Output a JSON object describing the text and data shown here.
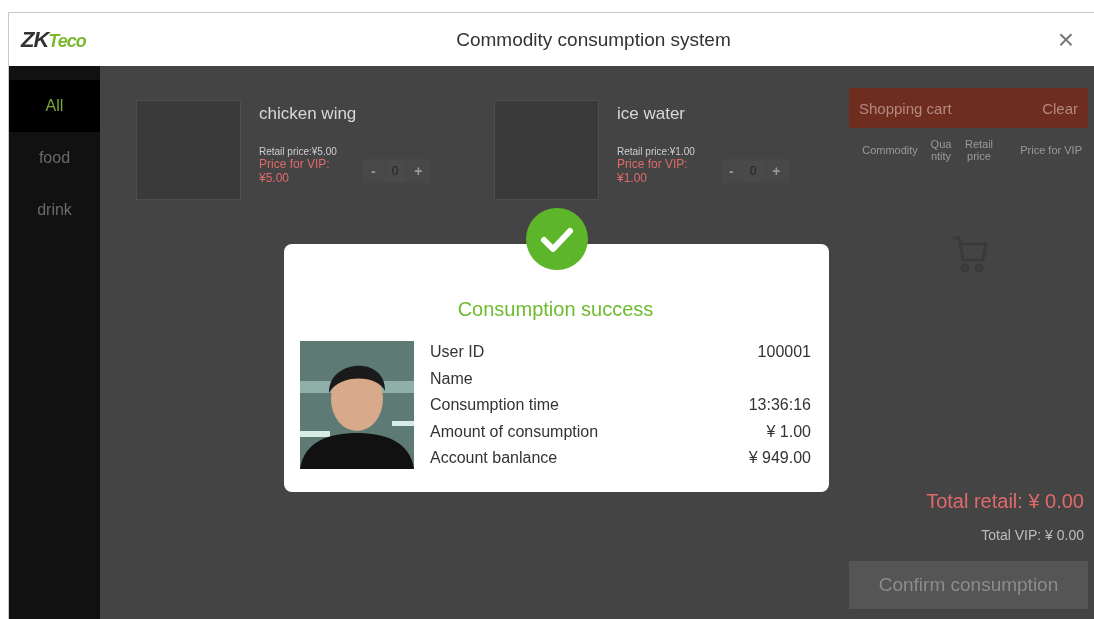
{
  "window": {
    "title": "Commodity consumption system",
    "close": "×"
  },
  "logo": {
    "dark": "ZK",
    "accent": "Teco"
  },
  "categories": [
    {
      "label": "All",
      "selected": true
    },
    {
      "label": "food",
      "selected": false
    },
    {
      "label": "drink",
      "selected": false
    }
  ],
  "products": [
    {
      "name": "chicken wing",
      "retail": "Retail price:¥5.00",
      "vip": "Price for VIP: ¥5.00",
      "minus": "-",
      "quantity": "0",
      "plus": "+"
    },
    {
      "name": "ice water",
      "retail": "Retail price:¥1.00",
      "vip": "Price for VIP: ¥1.00",
      "minus": "-",
      "quantity": "0",
      "plus": "+"
    }
  ],
  "cart": {
    "title": "Shopping cart",
    "clear": "Clear",
    "columns": [
      "Commodity",
      "Quantity",
      "Retail price",
      "Price for VIP"
    ],
    "total_retail": "Total retail: ¥ 0.00",
    "total_vip": "Total VIP: ¥ 0.00",
    "confirm": "Confirm consumption"
  },
  "dialog": {
    "title": "Consumption success",
    "rows": [
      {
        "label": "User ID",
        "value": "100001"
      },
      {
        "label": "Name"
      },
      {
        "label": "Consumption time",
        "value": "13:36:16"
      },
      {
        "label": "Amount of consumption",
        "value": "¥ 1.00"
      },
      {
        "label": "Account banlance",
        "value": "¥ 949.00"
      }
    ]
  }
}
